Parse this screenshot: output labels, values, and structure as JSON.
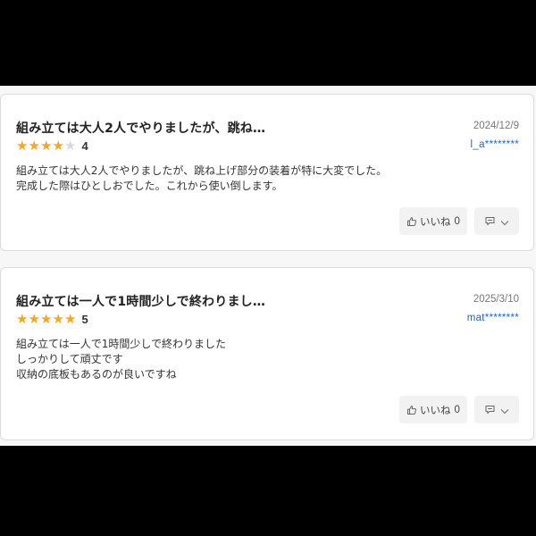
{
  "colors": {
    "star_on": "#f5a623",
    "star_off": "#d8d8d8",
    "reviewer_link": "#1a66cc",
    "button_bg": "#f2f2f2"
  },
  "reviews": [
    {
      "title": "組み立ては大人2人でやりましたが、跳ね…",
      "date": "2024/12/9",
      "rating": 4,
      "rating_label": "4",
      "reviewer": "l_a********",
      "body": [
        "組み立ては大人2人でやりましたが、跳ね上げ部分の装着が特に大変でした。",
        "完成した際はひとしおでした。これから使い倒します。"
      ],
      "helpful_label": "いいね",
      "helpful_count": "0",
      "icons": {
        "helpful": "thumbs-up-icon",
        "menu": "comment-icon",
        "expand": "chevron-down-icon"
      }
    },
    {
      "title": "組み立ては一人で1時間少しで終わりまし…",
      "date": "2025/3/10",
      "rating": 5,
      "rating_label": "5",
      "reviewer": "mat********",
      "body": [
        "組み立ては一人で1時間少しで終わりました",
        "しっかりして頑丈です",
        "収納の底板もあるのが良いですね"
      ],
      "helpful_label": "いいね",
      "helpful_count": "0",
      "icons": {
        "helpful": "thumbs-up-icon",
        "menu": "comment-icon",
        "expand": "chevron-down-icon"
      }
    }
  ]
}
